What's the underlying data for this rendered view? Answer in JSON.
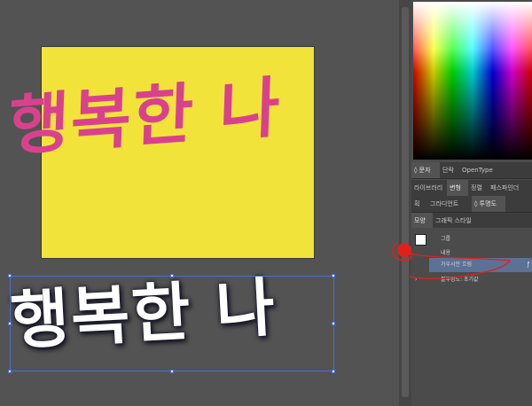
{
  "canvas": {
    "pink_text": "행복한 나",
    "white_text": "행복한 나",
    "artboard_color": "#f2e33a",
    "pink_color": "#d9418e"
  },
  "panel": {
    "tabs_row1": [
      "◊ 문자",
      "단락",
      "OpenType"
    ],
    "tabs_row2": [
      "라이브러리",
      "변형",
      "정렬",
      "패스파인더"
    ],
    "tabs_row3": [
      "획",
      "그라디언트",
      "◊ 투명도"
    ],
    "tabs_row4": [
      "모양",
      "그래픽 스타일"
    ],
    "appearance": {
      "group_label": "그룹",
      "contents_label": "내용",
      "effect_label": "가우시안 흐림",
      "opacity_label": "불투명도: 초기값"
    }
  }
}
